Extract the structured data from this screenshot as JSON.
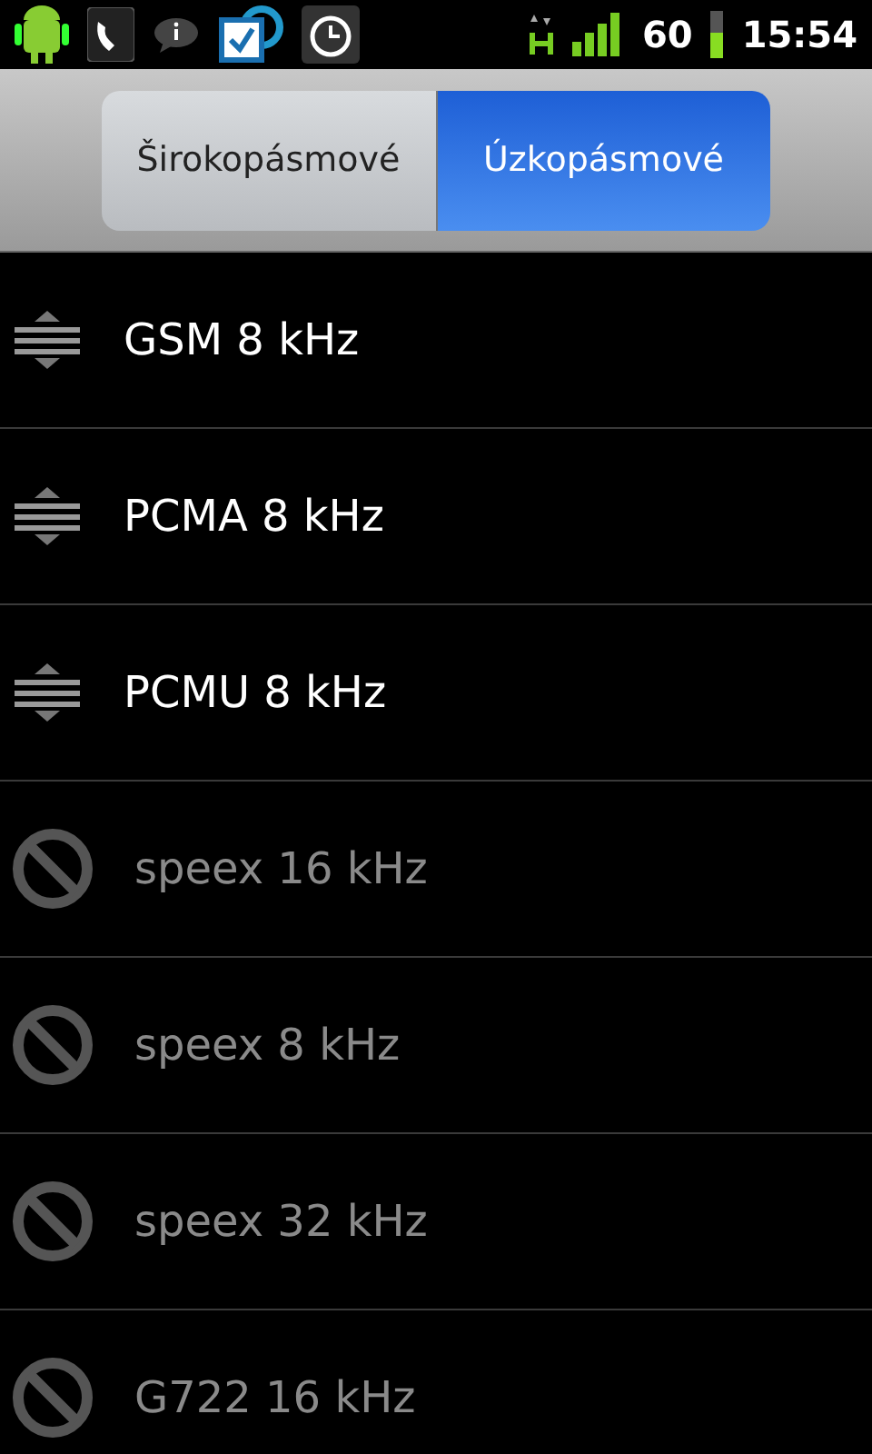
{
  "status_bar": {
    "battery": "60",
    "time": "15:54"
  },
  "tabs": [
    {
      "label": "Širokopásmové",
      "selected": false
    },
    {
      "label": "Úzkopásmové",
      "selected": true
    }
  ],
  "codecs": [
    {
      "name": "GSM 8 kHz",
      "enabled": true
    },
    {
      "name": "PCMA 8 kHz",
      "enabled": true
    },
    {
      "name": "PCMU 8 kHz",
      "enabled": true
    },
    {
      "name": "speex 16 kHz",
      "enabled": false
    },
    {
      "name": "speex 8 kHz",
      "enabled": false
    },
    {
      "name": "speex 32 kHz",
      "enabled": false
    },
    {
      "name": "G722 16 kHz",
      "enabled": false
    }
  ]
}
